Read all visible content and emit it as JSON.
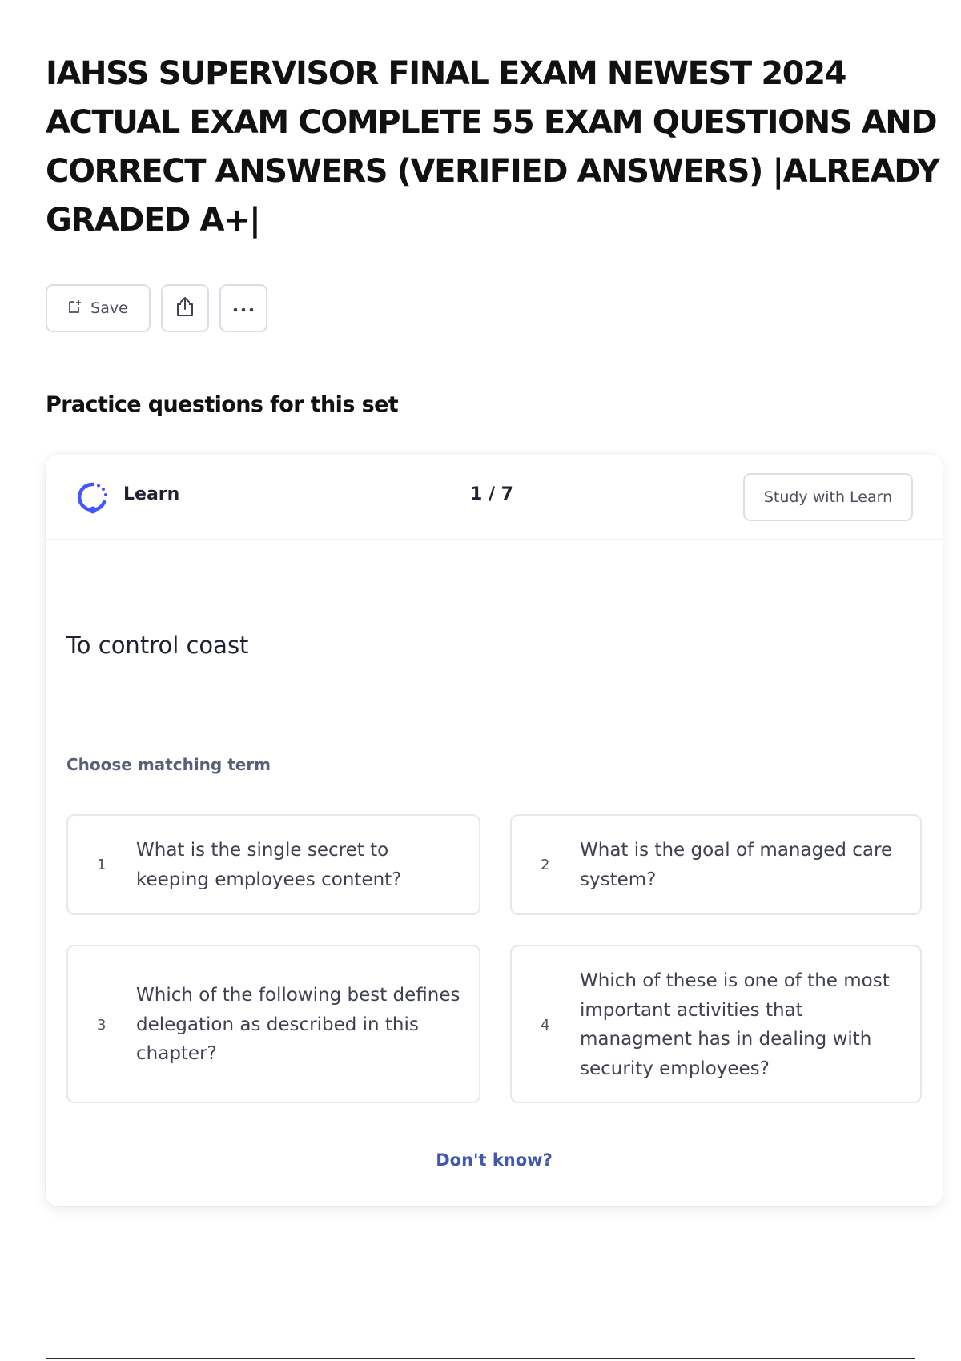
{
  "document": {
    "title": "IAHSS SUPERVISOR FINAL EXAM NEWEST 2024 ACTUAL EXAM COMPLETE 55 EXAM QUESTIONS AND CORRECT ANSWERS (VERIFIED ANSWERS) |ALREADY GRADED A+|"
  },
  "actions": {
    "save_label": "Save",
    "save_icon": "bookmark-add-icon",
    "share_icon": "share-icon",
    "more_icon": "more-horizontal-icon"
  },
  "practice": {
    "section_title": "Practice questions for this set",
    "mode_label": "Learn",
    "mode_icon": "learn-progress-icon",
    "progress": "1 / 7",
    "study_button_label": "Study with Learn",
    "prompt": "To control coast",
    "instruction": "Choose matching term",
    "options": [
      {
        "number": "1",
        "text": "What is the single secret to keeping employees content?"
      },
      {
        "number": "2",
        "text": "What is the goal of managed care system?"
      },
      {
        "number": "3",
        "text": "Which of the following best defines delegation as described in this chapter?"
      },
      {
        "number": "4",
        "text": "Which of these is one of the most important activities that managment has in dealing with security employees?"
      }
    ],
    "dont_know_label": "Don't know?"
  },
  "colors": {
    "accent": "#4257b2",
    "learn_icon": "#4255ff"
  }
}
